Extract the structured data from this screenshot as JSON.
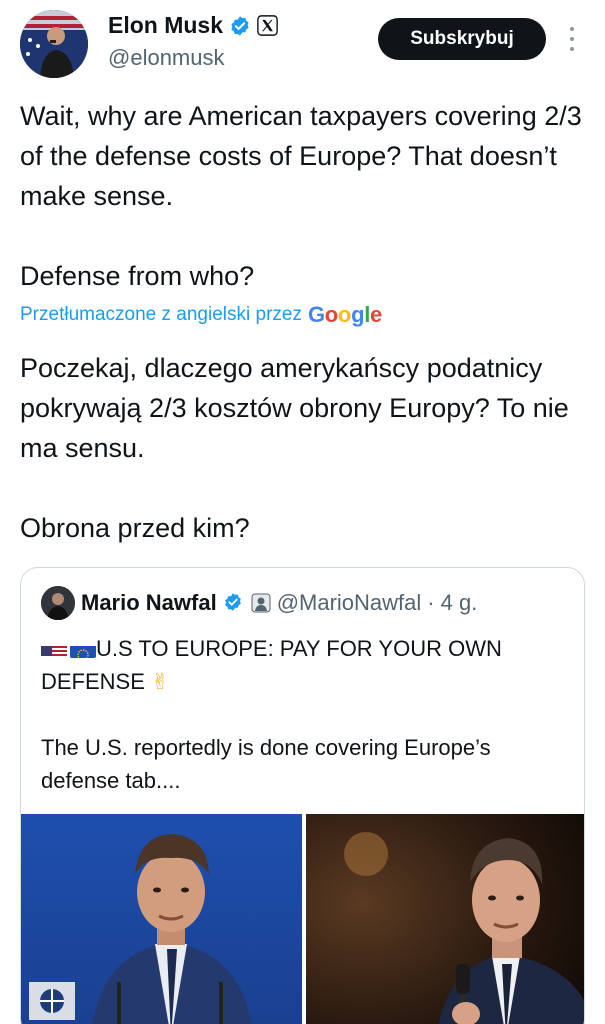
{
  "author": {
    "name": "Elon Musk",
    "handle": "@elonmusk",
    "verified_icon": "verified-badge-icon",
    "affiliation_icon": "x-logo-icon"
  },
  "actions": {
    "subscribe_label": "Subskrybuj",
    "more_icon": "more-vertical-icon"
  },
  "tweet": {
    "paragraphs": [
      "Wait, why are American taxpayers covering 2/3 of the defense costs of Europe? That doesn’t make sense.",
      "Defense from who?"
    ]
  },
  "translation": {
    "notice": "Przetłumaczone z angielski przez",
    "provider": "Google",
    "paragraphs": [
      "Poczekaj, dlaczego amerykańscy podatnicy pokrywają 2/3 kosztów obrony Europy? To nie ma sensu.",
      "Obrona przed kim?"
    ]
  },
  "quoted": {
    "name": "Mario Nawfal",
    "handle": "@MarioNawfal",
    "separator": "·",
    "time": "4 g.",
    "headline": "U.S TO EUROPE: PAY FOR YOUR OWN DEFENSE",
    "headline_emoji": "✌",
    "body": "The U.S. reportedly is done covering Europe’s defense tab....",
    "images": [
      "man-in-suit-at-podium-photo",
      "man-speaking-with-microphone-photo"
    ]
  },
  "colors": {
    "accent": "#1d9bf0",
    "text_primary": "#0f1419",
    "text_secondary": "#536471",
    "border": "#cfd9de"
  }
}
